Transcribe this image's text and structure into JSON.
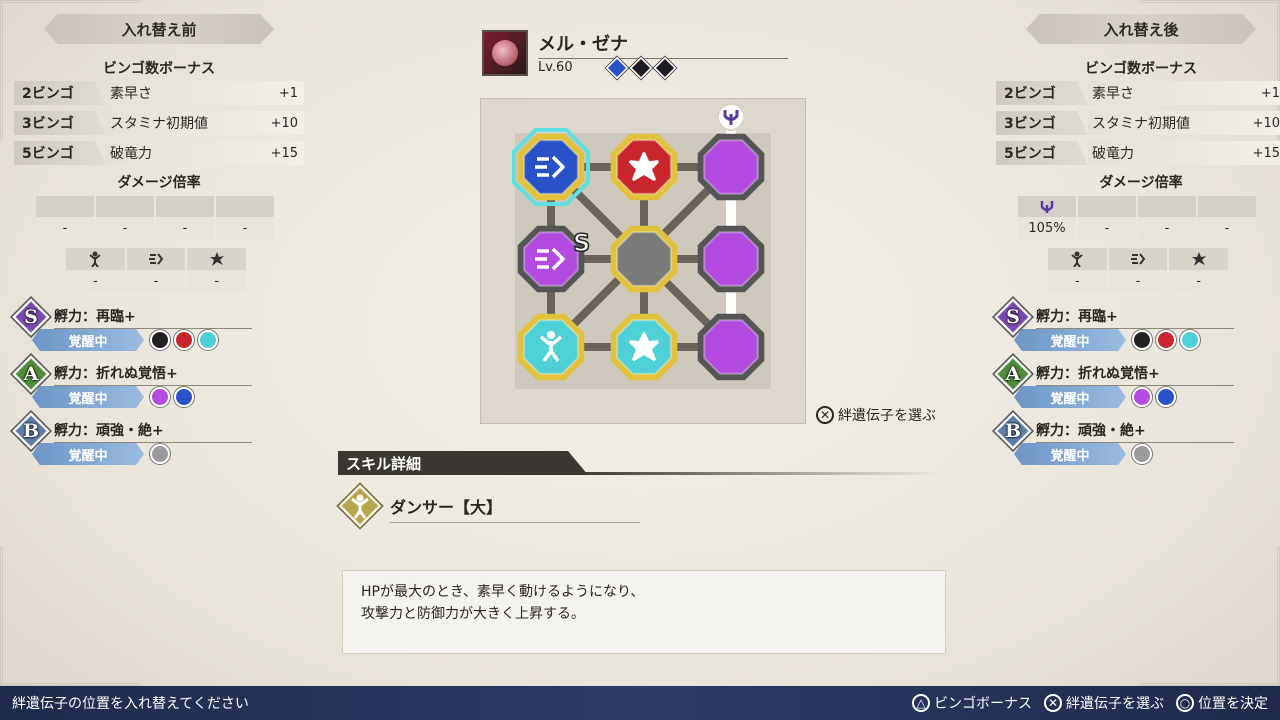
{
  "left_panel": {
    "title": "入れ替え前",
    "bingo_title": "ビンゴ数ボーナス",
    "bonuses": [
      {
        "key": "2ビンゴ",
        "stat": "素早さ",
        "value": "+1"
      },
      {
        "key": "3ビンゴ",
        "stat": "スタミナ初期値",
        "value": "+10"
      },
      {
        "key": "5ビンゴ",
        "stat": "破竜力",
        "value": "+15"
      }
    ],
    "damage_title": "ダメージ倍率",
    "damage": [
      "-",
      "-",
      "-",
      "-"
    ],
    "attrs": [
      "-",
      "-",
      "-"
    ],
    "skills": [
      {
        "grade": "S",
        "name": "孵力：再臨+",
        "status": "覚醒中",
        "color": "#7a4bb0"
      },
      {
        "grade": "A",
        "name": "孵力：折れぬ覚悟+",
        "status": "覚醒中",
        "color": "#4d8c3a"
      },
      {
        "grade": "B",
        "name": "孵力：頑強・絶+",
        "status": "覚醒中",
        "color": "#5c7ea8"
      }
    ]
  },
  "right_panel": {
    "title": "入れ替え後",
    "bingo_title": "ビンゴ数ボーナス",
    "bonuses": [
      {
        "key": "2ビンゴ",
        "stat": "素早さ",
        "value": "+1"
      },
      {
        "key": "3ビンゴ",
        "stat": "スタミナ初期値",
        "value": "+10"
      },
      {
        "key": "5ビンゴ",
        "stat": "破竜力",
        "value": "+15"
      }
    ],
    "damage_title": "ダメージ倍率",
    "damage": [
      "105%",
      "-",
      "-",
      "-"
    ],
    "attrs": [
      "-",
      "-",
      "-"
    ],
    "skills": [
      {
        "grade": "S",
        "name": "孵力：再臨+",
        "status": "覚醒中",
        "color": "#7a4bb0"
      },
      {
        "grade": "A",
        "name": "孵力：折れぬ覚悟+",
        "status": "覚醒中",
        "color": "#4d8c3a"
      },
      {
        "grade": "B",
        "name": "孵力：頑強・絶+",
        "status": "覚醒中",
        "color": "#5c7ea8"
      }
    ]
  },
  "monster": {
    "name": "メル・ゼナ",
    "level": "Lv.60",
    "elements": [
      "speed-icon",
      "fang-icon",
      "fang-icon"
    ]
  },
  "board": {
    "s_marker": "S",
    "cells": [
      {
        "color": "#2a52c8",
        "ring": "#e2c23c",
        "icon": "speed-icon",
        "selected": true
      },
      {
        "color": "#c8262c",
        "ring": "#e2c23c",
        "icon": "burst-icon"
      },
      {
        "color": "#b34be0",
        "ring": "#555",
        "icon": ""
      },
      {
        "color": "#b34be0",
        "ring": "#555",
        "icon": "speed-icon"
      },
      {
        "color": "#7a7a7a",
        "ring": "#e2c23c",
        "icon": ""
      },
      {
        "color": "#b34be0",
        "ring": "#555",
        "icon": ""
      },
      {
        "color": "#4fd0d6",
        "ring": "#e2c23c",
        "icon": "dancer-icon"
      },
      {
        "color": "#4fd0d6",
        "ring": "#e2c23c",
        "icon": "burst-icon"
      },
      {
        "color": "#b34be0",
        "ring": "#555",
        "icon": ""
      }
    ],
    "choose_hint": "絆遺伝子を選ぶ",
    "choose_glyph": "✕"
  },
  "detail": {
    "header": "スキル詳細",
    "skill_name": "ダンサー【大】",
    "desc_line1": "HPが最大のとき、素早く動けるようになり、",
    "desc_line2": "攻撃力と防御力が大きく上昇する。"
  },
  "bottom": {
    "instruction": "絆遺伝子の位置を入れ替えてください",
    "actions": [
      {
        "glyph": "△",
        "label": "ビンゴボーナス"
      },
      {
        "glyph": "✕",
        "label": "絆遺伝子を選ぶ"
      },
      {
        "glyph": "○",
        "label": "位置を決定"
      }
    ]
  },
  "colors": {
    "accent_blue": "#6c95c6",
    "bar_navy": "#1d2a4a",
    "gold": "#e2c23c"
  }
}
